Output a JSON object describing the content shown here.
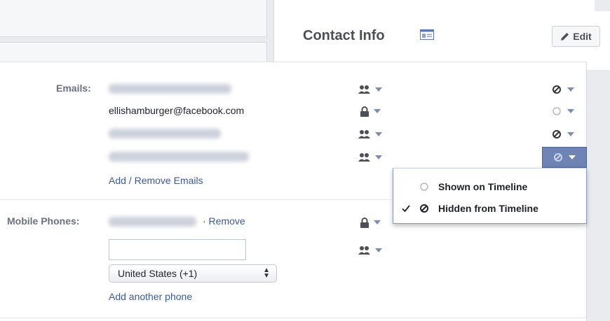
{
  "header": {
    "title": "Contact Info",
    "edit_label": "Edit"
  },
  "emails": {
    "label": "Emails:",
    "visible_address": "ellishamburger@facebook.com",
    "add_remove_link": "Add / Remove Emails"
  },
  "phones": {
    "label": "Mobile Phones:",
    "remove_link": "· Remove",
    "country_select_value": "United States (+1)",
    "add_phone_link": "Add another phone",
    "phone_input_value": ""
  },
  "timeline_menu": {
    "options": [
      "Shown on Timeline",
      "Hidden from Timeline"
    ],
    "selected": "Hidden from Timeline"
  },
  "colors": {
    "link": "#3b5998",
    "selected_control": "#6d84b4",
    "caret": "#7b8db5"
  },
  "icons": {
    "friends": "friends-audience-icon",
    "lock": "lock-icon",
    "hidden": "hidden-circle-slash-icon",
    "shown": "open-circle-icon",
    "pencil": "pencil-icon",
    "card": "contact-card-icon",
    "check": "checkmark-icon"
  }
}
